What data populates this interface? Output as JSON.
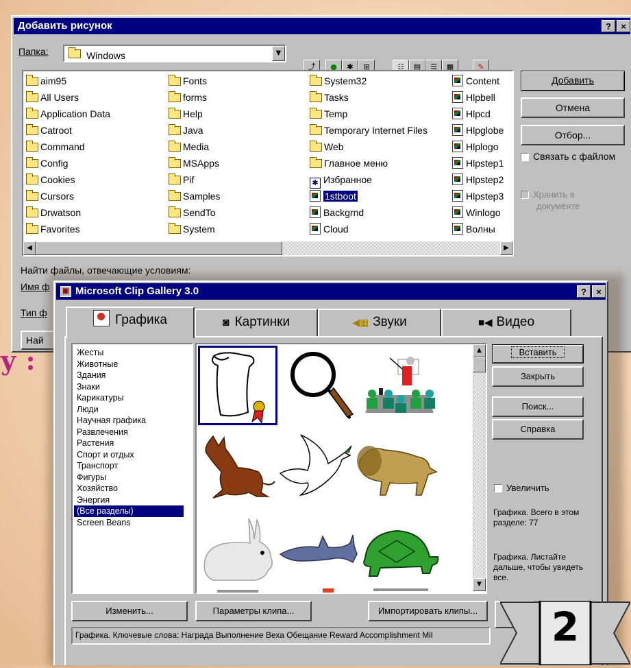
{
  "bg_char": "у :",
  "page_badge": "2",
  "insert_picture_dialog": {
    "title": "Добавить рисунок",
    "help_btn": "?",
    "close_btn": "×",
    "folder_label": "Папка:",
    "folder_value": "Windows",
    "find_label": "Найти файлы, отвечающие условиям:",
    "name_label": "Имя ф",
    "type_label": "Тип ф",
    "find_btn": "Най",
    "columns": [
      [
        {
          "name": "aim95",
          "type": "folder"
        },
        {
          "name": "All Users",
          "type": "folder"
        },
        {
          "name": "Application Data",
          "type": "folder"
        },
        {
          "name": "Catroot",
          "type": "folder"
        },
        {
          "name": "Command",
          "type": "folder"
        },
        {
          "name": "Config",
          "type": "folder"
        },
        {
          "name": "Cookies",
          "type": "folder"
        },
        {
          "name": "Cursors",
          "type": "folder"
        },
        {
          "name": "Drwatson",
          "type": "folder"
        },
        {
          "name": "Favorites",
          "type": "folder"
        }
      ],
      [
        {
          "name": "Fonts",
          "type": "folder"
        },
        {
          "name": "forms",
          "type": "folder"
        },
        {
          "name": "Help",
          "type": "folder"
        },
        {
          "name": "Java",
          "type": "folder"
        },
        {
          "name": "Media",
          "type": "folder"
        },
        {
          "name": "MSApps",
          "type": "folder"
        },
        {
          "name": "Pif",
          "type": "folder"
        },
        {
          "name": "Samples",
          "type": "folder"
        },
        {
          "name": "SendTo",
          "type": "folder"
        },
        {
          "name": "System",
          "type": "folder"
        }
      ],
      [
        {
          "name": "System32",
          "type": "folder"
        },
        {
          "name": "Tasks",
          "type": "folder"
        },
        {
          "name": "Temp",
          "type": "folder"
        },
        {
          "name": "Temporary Internet Files",
          "type": "folder"
        },
        {
          "name": "Web",
          "type": "folder"
        },
        {
          "name": "Главное меню",
          "type": "folder"
        },
        {
          "name": "Избранное",
          "type": "star"
        },
        {
          "name": "1stboot",
          "type": "file",
          "selected": true
        },
        {
          "name": "Backgrnd",
          "type": "file"
        },
        {
          "name": "Cloud",
          "type": "file"
        }
      ],
      [
        {
          "name": "Content",
          "type": "file"
        },
        {
          "name": "Hlpbell",
          "type": "file"
        },
        {
          "name": "Hlpcd",
          "type": "file"
        },
        {
          "name": "Hlpglobe",
          "type": "file"
        },
        {
          "name": "Hlplogo",
          "type": "file"
        },
        {
          "name": "Hlpstep1",
          "type": "file"
        },
        {
          "name": "Hlpstep2",
          "type": "file"
        },
        {
          "name": "Hlpstep3",
          "type": "file"
        },
        {
          "name": "Winlogo",
          "type": "file"
        },
        {
          "name": "Волны",
          "type": "file"
        }
      ]
    ],
    "buttons": {
      "add": "Добавить",
      "cancel": "Отмена",
      "filter": "Отбор..."
    },
    "link_checkbox": "Связать с файлом",
    "store_checkbox_line1": "Хранить в",
    "store_checkbox_line2": "документе"
  },
  "clip_gallery": {
    "title": "Microsoft Clip Gallery 3.0",
    "help_btn": "?",
    "close_btn": "×",
    "tabs": [
      {
        "label": "Графика",
        "icon": "clipart-icon"
      },
      {
        "label": "Картинки",
        "icon": "camera-icon"
      },
      {
        "label": "Звуки",
        "icon": "speaker-icon"
      },
      {
        "label": "Видео",
        "icon": "video-camera-icon"
      }
    ],
    "categories": [
      "Жесты",
      "Животные",
      "Здания",
      "Знаки",
      "Карикатуры",
      "Люди",
      "Научная графика",
      "Развлечения",
      "Растения",
      "Спорт и отдых",
      "Транспорт",
      "Фигуры",
      "Хозяйство",
      "Энергия",
      "(Все разделы)",
      "Screen Beans"
    ],
    "selected_category": 14,
    "buttons": {
      "insert": "Вставить",
      "close": "Закрыть",
      "search": "Поиск...",
      "help": "Справка",
      "edit": "Изменить...",
      "clip_props": "Параметры клипа...",
      "import": "Импортировать клипы..."
    },
    "enlarge_checkbox": "Увеличить",
    "info1": "Графика. Всего в этом разделе: 77",
    "info2": "Графика. Листайте дальше, чтобы увидеть все.",
    "status": "Графика. Ключевые слова:  Награда Выполнение Веха Обещание Reward Accomplishment Mil",
    "clips": [
      "scroll-diploma",
      "magnifier",
      "presentation",
      "donkey",
      "dove",
      "lion",
      "rabbit",
      "shark",
      "turtle"
    ]
  }
}
